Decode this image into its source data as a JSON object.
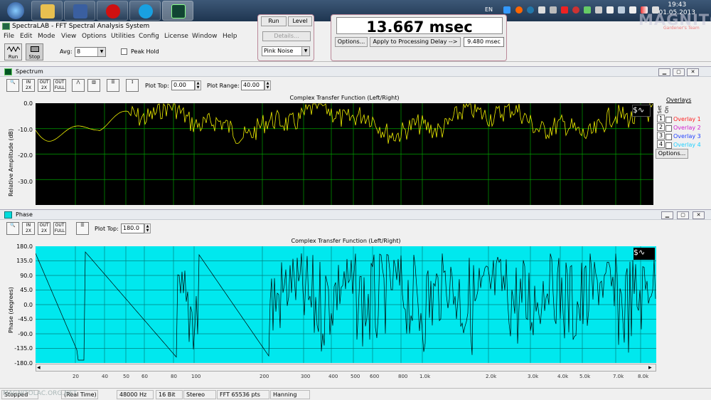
{
  "taskbar": {
    "language": "EN",
    "clock_time": "19:43",
    "clock_date": "01.05.2013"
  },
  "watermark": {
    "logo": "MAGNITOLA",
    "sub": "Gardener's Team",
    "bottom": "MAGNITOLAC.ORG.NET"
  },
  "app": {
    "title": "SpectraLAB - FFT Spectral Analysis System"
  },
  "menu": [
    "File",
    "Edit",
    "Mode",
    "View",
    "Options",
    "Utilities",
    "Config",
    "License",
    "Window",
    "Help"
  ],
  "toolbar": {
    "run_label": "Run",
    "stop_label": "Stop",
    "avg_label": "Avg:",
    "avg_value": "8",
    "peak_hold_label": "Peak Hold"
  },
  "generator": {
    "run_label": "Run",
    "level_label": "Level",
    "details_label": "Details...",
    "signal": "Pink Noise"
  },
  "delay": {
    "value": "13.667 msec",
    "options_label": "Options...",
    "apply_label": "Apply to Processing Delay -->",
    "processing_delay": "9.480 msec"
  },
  "spectrum": {
    "panel_title": "Spectrum",
    "plot_top_label": "Plot Top:",
    "plot_top_value": "0.00",
    "plot_range_label": "Plot Range:",
    "plot_range_value": "40.00",
    "plot_title": "Complex Transfer Function (Left/Right)",
    "ylabel": "Relative Amplitude (dB)",
    "yticks": [
      "0.0",
      "-10.0",
      "-20.0",
      "-30.0"
    ],
    "overlays_title": "Overlays",
    "set_label": "Set",
    "on_label": "On",
    "overlays": [
      {
        "num": "1",
        "name": "Overlay 1",
        "color": "#ff2020"
      },
      {
        "num": "2",
        "name": "Overlay 2",
        "color": "#d020d0"
      },
      {
        "num": "3",
        "name": "Overlay 3",
        "color": "#2040ff"
      },
      {
        "num": "4",
        "name": "Overlay 4",
        "color": "#20d0ff"
      }
    ],
    "options_label": "Options..."
  },
  "phase": {
    "panel_title": "Phase",
    "plot_top_label": "Plot Top:",
    "plot_top_value": "180.0",
    "plot_title": "Complex Transfer Function (Left/Right)",
    "ylabel": "Phase (degrees)",
    "yticks": [
      "180.0",
      "135.0",
      "90.0",
      "45.0",
      "0.0",
      "-45.0",
      "-90.0",
      "-135.0",
      "-180.0"
    ]
  },
  "xaxis_ticks": [
    {
      "label": "20",
      "x": 102
    },
    {
      "label": "40",
      "x": 143
    },
    {
      "label": "50",
      "x": 173
    },
    {
      "label": "60",
      "x": 199
    },
    {
      "label": "80",
      "x": 240
    },
    {
      "label": "100",
      "x": 269
    },
    {
      "label": "200",
      "x": 365
    },
    {
      "label": "300",
      "x": 423
    },
    {
      "label": "400",
      "x": 462
    },
    {
      "label": "500",
      "x": 493
    },
    {
      "label": "600",
      "x": 520
    },
    {
      "label": "800",
      "x": 560
    },
    {
      "label": "1.0k",
      "x": 590
    },
    {
      "label": "2.0k",
      "x": 683
    },
    {
      "label": "3.0k",
      "x": 742
    },
    {
      "label": "4.0k",
      "x": 784
    },
    {
      "label": "5.0k",
      "x": 815
    },
    {
      "label": "7.0k",
      "x": 862
    },
    {
      "label": "8.0k",
      "x": 897
    }
  ],
  "statusbar": {
    "state": "Stopped",
    "mode": "(Real Time)",
    "rate": "48000 Hz",
    "bits": "16 Bit",
    "channels": "Stereo",
    "fft": "FFT 65536 pts",
    "window": "Hanning"
  },
  "colors": {
    "spectrum_bg": "#000000",
    "spectrum_trace": "#f0f000",
    "spectrum_grid": "#00a000",
    "phase_bg": "#00e8ee",
    "phase_trace": "#000000",
    "phase_grid": "#008080"
  }
}
